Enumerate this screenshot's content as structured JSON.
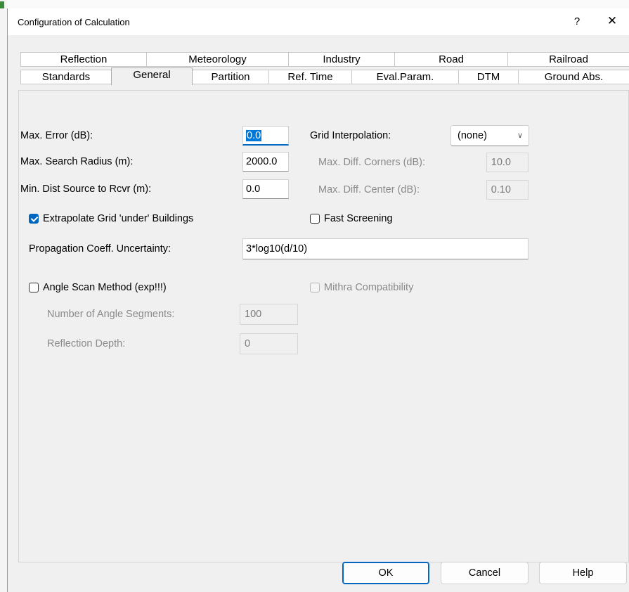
{
  "window": {
    "title": "Configuration of Calculation",
    "help_glyph": "?",
    "close_glyph": "✕"
  },
  "tabs": {
    "row_top": [
      "Reflection",
      "Meteorology",
      "Industry",
      "Road",
      "Railroad"
    ],
    "row_bottom": [
      "Standards",
      "General",
      "Partition",
      "Ref. Time",
      "Eval.Param.",
      "DTM",
      "Ground Abs."
    ],
    "active": "General"
  },
  "general": {
    "max_error_label": "Max. Error (dB):",
    "max_error_value": "0.0",
    "max_search_radius_label": "Max. Search Radius (m):",
    "max_search_radius_value": "2000.0",
    "min_dist_label": "Min. Dist Source to Rcvr (m):",
    "min_dist_value": "0.0",
    "grid_interp_label": "Grid Interpolation:",
    "grid_interp_value": "(none)",
    "max_diff_corners_label": "Max. Diff. Corners (dB):",
    "max_diff_corners_value": "10.0",
    "max_diff_center_label": "Max. Diff. Center (dB):",
    "max_diff_center_value": "0.10",
    "extrapolate_label": "Extrapolate Grid 'under' Buildings",
    "extrapolate_checked": true,
    "fast_screening_label": "Fast Screening",
    "fast_screening_checked": false,
    "prop_coeff_label": "Propagation Coeff. Uncertainty:",
    "prop_coeff_value": "3*log10(d/10)",
    "angle_scan_label": "Angle Scan Method (exp!!!)",
    "angle_scan_checked": false,
    "mithra_label": "Mithra Compatibility",
    "mithra_checked": false,
    "angle_segments_label": "Number of Angle Segments:",
    "angle_segments_value": "100",
    "reflection_depth_label": "Reflection Depth:",
    "reflection_depth_value": "0"
  },
  "buttons": {
    "ok": "OK",
    "cancel": "Cancel",
    "help": "Help"
  }
}
